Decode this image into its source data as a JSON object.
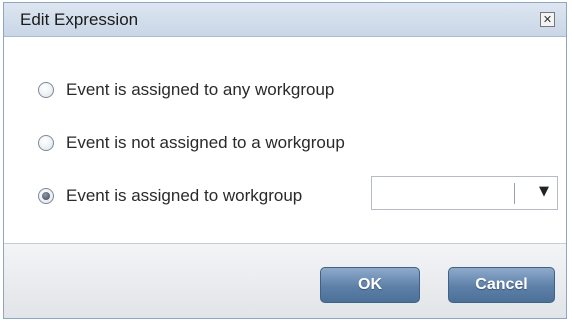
{
  "dialog": {
    "title": "Edit Expression",
    "close_glyph": "✕"
  },
  "options": [
    {
      "label": "Event is assigned to any workgroup",
      "checked": false
    },
    {
      "label": "Event is not assigned to a workgroup",
      "checked": false
    },
    {
      "label": "Event is assigned to workgroup",
      "checked": true
    }
  ],
  "workgroup_select": {
    "value": "",
    "arrow_glyph": "▼"
  },
  "buttons": {
    "ok_label": "OK",
    "cancel_label": "Cancel"
  },
  "colors": {
    "titlebar": "#c9d6e6",
    "button_accent": "#5d80a8"
  },
  "icons": {
    "close": "close-icon",
    "dropdown": "chevron-down-icon"
  }
}
